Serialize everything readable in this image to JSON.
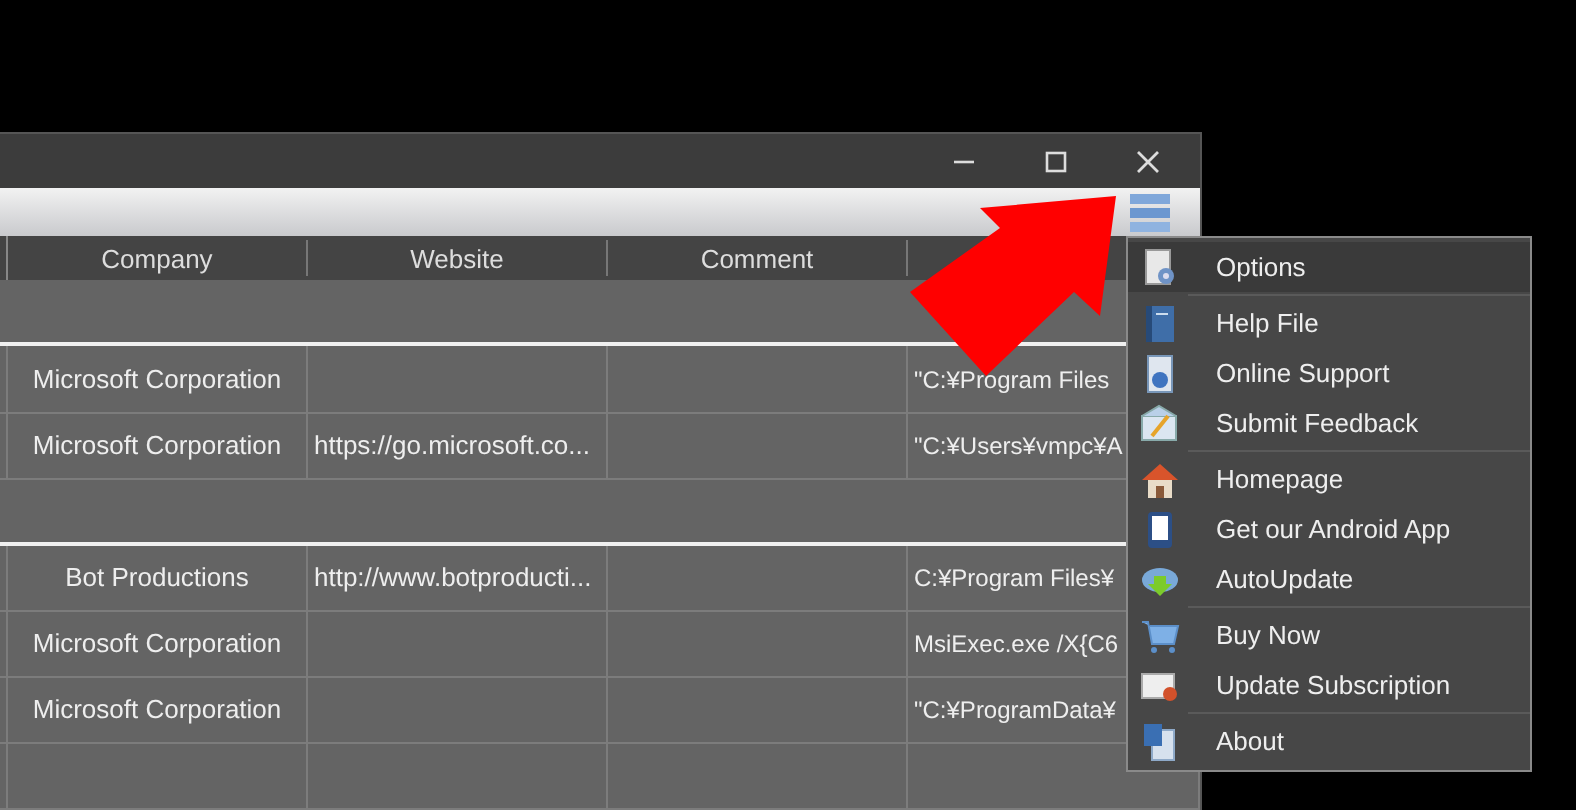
{
  "table": {
    "columns": [
      {
        "label": "Company"
      },
      {
        "label": "Website"
      },
      {
        "label": "Comment"
      }
    ],
    "rows": [
      {
        "kind": "group"
      },
      {
        "kind": "row",
        "cells": [
          "Microsoft Corporation",
          "",
          "",
          "\"C:¥Program Files"
        ]
      },
      {
        "kind": "row",
        "cells": [
          "Microsoft Corporation",
          "https://go.microsoft.co...",
          "",
          "\"C:¥Users¥vmpc¥A"
        ]
      },
      {
        "kind": "group"
      },
      {
        "kind": "row",
        "cells": [
          "Bot Productions",
          "http://www.botproducti...",
          "",
          "C:¥Program Files¥"
        ]
      },
      {
        "kind": "row",
        "cells": [
          "Microsoft Corporation",
          "",
          "",
          "MsiExec.exe /X{C6"
        ]
      },
      {
        "kind": "row",
        "cells": [
          "Microsoft Corporation",
          "",
          "",
          "\"C:¥ProgramData¥"
        ]
      },
      {
        "kind": "row",
        "cells": [
          "",
          "",
          "",
          ""
        ]
      }
    ]
  },
  "menu": {
    "items": [
      {
        "kind": "item",
        "label": "Options",
        "selected": true
      },
      {
        "kind": "separator"
      },
      {
        "kind": "item",
        "label": "Help File",
        "selected": false
      },
      {
        "kind": "item",
        "label": "Online Support",
        "selected": false
      },
      {
        "kind": "item",
        "label": "Submit Feedback",
        "selected": false
      },
      {
        "kind": "separator"
      },
      {
        "kind": "item",
        "label": "Homepage",
        "selected": false
      },
      {
        "kind": "item",
        "label": "Get our Android App",
        "selected": false
      },
      {
        "kind": "item",
        "label": "AutoUpdate",
        "selected": false
      },
      {
        "kind": "separator"
      },
      {
        "kind": "item",
        "label": "Buy Now",
        "selected": false
      },
      {
        "kind": "item",
        "label": "Update Subscription",
        "selected": false
      },
      {
        "kind": "separator"
      },
      {
        "kind": "item",
        "label": "About",
        "selected": false
      }
    ]
  }
}
